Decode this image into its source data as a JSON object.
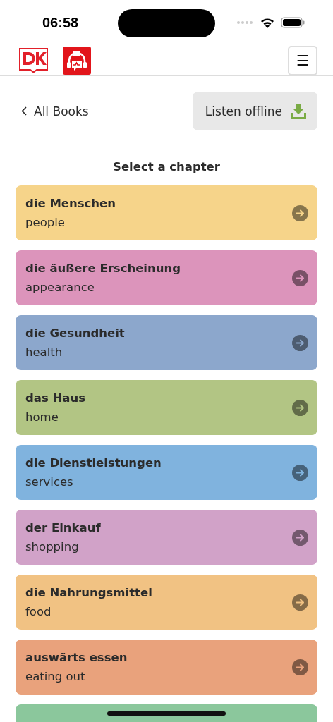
{
  "status_bar": {
    "time": "06:58"
  },
  "header": {
    "menu_button": "☰"
  },
  "nav": {
    "back_link": "All Books",
    "offline_button": "Listen offline"
  },
  "heading": "Select a chapter",
  "chapters": [
    {
      "title": "die Menschen",
      "subtitle": "people",
      "color": "#f6d48a"
    },
    {
      "title": "die äußere Erscheinung",
      "subtitle": "appearance",
      "color": "#dc94bb"
    },
    {
      "title": "die Gesundheit",
      "subtitle": "health",
      "color": "#8ca7cc"
    },
    {
      "title": "das Haus",
      "subtitle": "home",
      "color": "#b2c584"
    },
    {
      "title": "die Dienstleistungen",
      "subtitle": "services",
      "color": "#80b3de"
    },
    {
      "title": "der Einkauf",
      "subtitle": "shopping",
      "color": "#d1a2c8"
    },
    {
      "title": "die Nahrungsmittel",
      "subtitle": "food",
      "color": "#f1c283"
    },
    {
      "title": "auswärts essen",
      "subtitle": "eating out",
      "color": "#e9a27c"
    },
    {
      "color": "#8bc79c"
    }
  ]
}
